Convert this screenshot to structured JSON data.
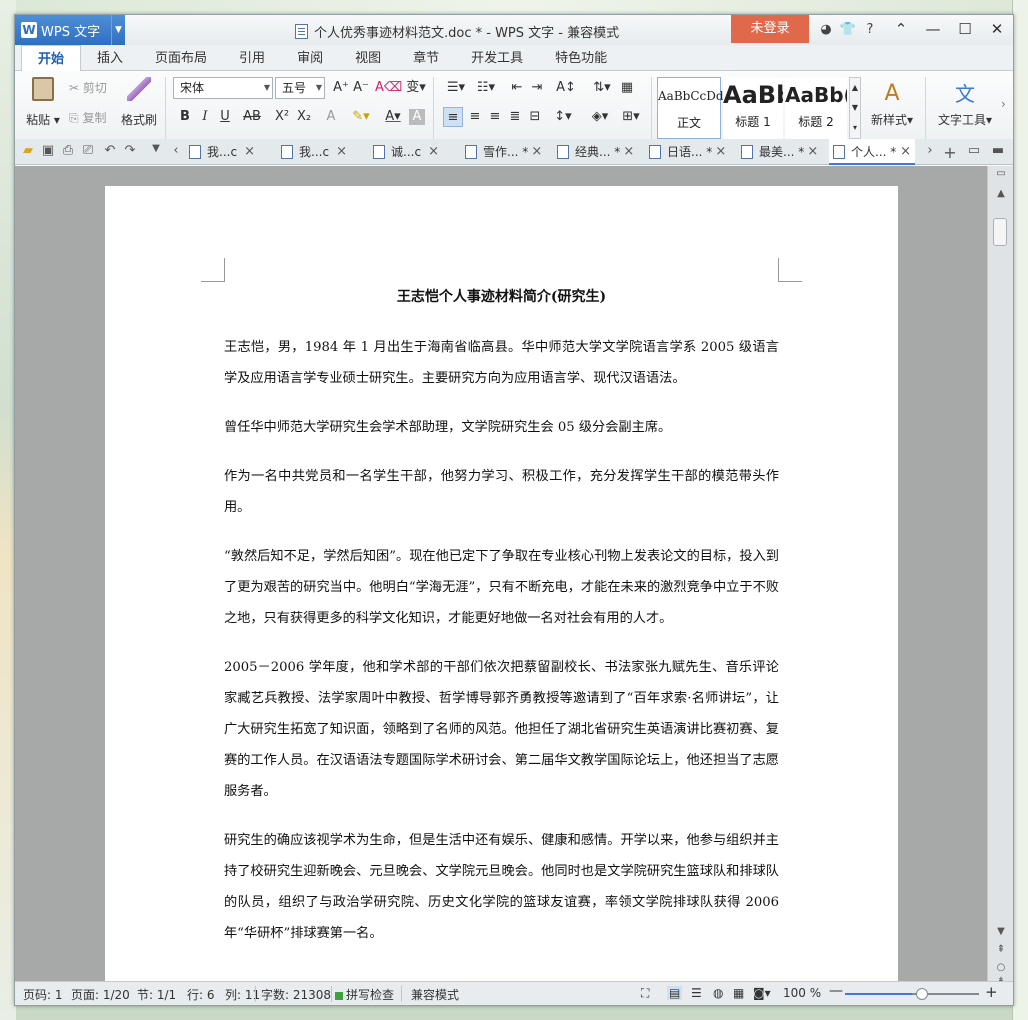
{
  "app": {
    "button_label": "WPS 文字",
    "doc_title": "个人优秀事迹材料范文.doc * - WPS 文字 - 兼容模式",
    "login_label": "未登录",
    "help_label": "?"
  },
  "menu_tabs": [
    "开始",
    "插入",
    "页面布局",
    "引用",
    "审阅",
    "视图",
    "章节",
    "开发工具",
    "特色功能"
  ],
  "ribbon": {
    "paste": "粘贴",
    "cut": "剪切",
    "copy": "复制",
    "format_painter": "格式刷",
    "font_name": "宋体",
    "font_size": "五号",
    "bold": "B",
    "italic": "I",
    "underline": "U",
    "strike": "AB",
    "superscript": "X²",
    "subscript": "X₂",
    "style_normal_preview": "AaBbCcDd",
    "style_normal": "正文",
    "style_h1_preview": "AaBb",
    "style_h1": "标题 1",
    "style_h2_preview": "AaBb(",
    "style_h2": "标题 2",
    "new_style": "新样式",
    "text_tools": "文字工具"
  },
  "doc_tabs": [
    {
      "label": "我...c",
      "active": false
    },
    {
      "label": "我...c",
      "active": false
    },
    {
      "label": "诚...c",
      "active": false
    },
    {
      "label": "雪作... *",
      "active": false
    },
    {
      "label": "经典... *",
      "active": false
    },
    {
      "label": "日语... *",
      "active": false
    },
    {
      "label": "最美... *",
      "active": false
    },
    {
      "label": "个人... *",
      "active": true
    }
  ],
  "document": {
    "heading": "王志恺个人事迹材料简介(研究生)",
    "paragraphs": [
      "王志恺，男，1984 年 1 月出生于海南省临高县。华中师范大学文学院语言学系 2005 级语言学及应用语言学专业硕士研究生。主要研究方向为应用语言学、现代汉语语法。",
      "曾任华中师范大学研究生会学术部助理，文学院研究生会 05 级分会副主席。",
      "作为一名中共党员和一名学生干部，他努力学习、积极工作，充分发挥学生干部的模范带头作用。",
      "“敦然后知不足，学然后知困”。现在他已定下了争取在专业核心刊物上发表论文的目标，投入到了更为艰苦的研究当中。他明白“学海无涯”，只有不断充电，才能在未来的激烈竞争中立于不败之地，只有获得更多的科学文化知识，才能更好地做一名对社会有用的人才。",
      "2005－2006 学年度，他和学术部的干部们依次把蔡留副校长、书法家张九赋先生、音乐评论家臧艺兵教授、法学家周叶中教授、哲学博导郭齐勇教授等邀请到了“百年求索·名师讲坛”，让广大研究生拓宽了知识面，领略到了名师的风范。他担任了湖北省研究生英语演讲比赛初赛、复赛的工作人员。在汉语语法专题国际学术研讨会、第二届华文教学国际论坛上，他还担当了志愿服务者。",
      "研究生的确应该视学术为生命，但是生活中还有娱乐、健康和感情。开学以来，他参与组织并主持了校研究生迎新晚会、元旦晚会、文学院元旦晚会。他同时也是文学院研究生篮球队和排球队的队员，组织了与政治学研究院、历史文化学院的篮球友谊赛，率领文学院排球队获得 2006 年“华研杯”排球赛第一名。"
    ]
  },
  "statusbar": {
    "page_no": "页码: 1",
    "pages": "页面: 1/20",
    "section": "节: 1/1",
    "row": "行: 6",
    "col": "列: 11",
    "word_count": "字数: 21308",
    "spell_check": "拼写检查",
    "compat_mode": "兼容模式",
    "zoom": "100 %",
    "zoom_fraction": 0.5
  },
  "colors": {
    "accent": "#2f6fc0",
    "login": "#e0694c",
    "doc_bg": "#a7a8a8"
  }
}
